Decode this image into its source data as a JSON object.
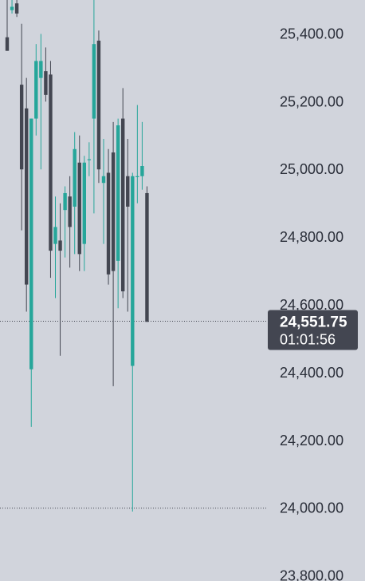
{
  "chart_data": {
    "type": "candlestick",
    "y_axis": {
      "ticks": [
        25400,
        25200,
        25000,
        24800,
        24600,
        24400,
        24200,
        24000,
        23800
      ],
      "tick_labels": [
        "25,400.00",
        "25,200.00",
        "25,000.00",
        "24,800.00",
        "24,600.00",
        "24,400.00",
        "24,200.00",
        "24,000.00",
        "23,800.00"
      ],
      "range": [
        23785,
        25500
      ]
    },
    "current_price": {
      "value": 24551.75,
      "label": "24,551.75",
      "countdown": "01:01:56"
    },
    "low_marker_value": 24000,
    "colors": {
      "background": "#d1d4dc",
      "up": "#26a69a",
      "down": "#434651",
      "badge": "#434651",
      "axis_text": "#2a2e39"
    },
    "candles": [
      {
        "o": 25390,
        "h": 25520,
        "l": 25350,
        "c": 25350
      },
      {
        "o": 25470,
        "h": 25520,
        "l": 25460,
        "c": 25480
      },
      {
        "o": 25490,
        "h": 25520,
        "l": 25450,
        "c": 25460
      },
      {
        "o": 25250,
        "h": 25430,
        "l": 24820,
        "c": 25000
      },
      {
        "o": 25180,
        "h": 25270,
        "l": 24580,
        "c": 24660
      },
      {
        "o": 24410,
        "h": 25150,
        "l": 24240,
        "c": 25150
      },
      {
        "o": 25150,
        "h": 25370,
        "l": 25100,
        "c": 25320
      },
      {
        "o": 25270,
        "h": 25400,
        "l": 25000,
        "c": 25320
      },
      {
        "o": 25290,
        "h": 25360,
        "l": 25200,
        "c": 25220
      },
      {
        "o": 25280,
        "h": 25320,
        "l": 24680,
        "c": 24760
      },
      {
        "o": 24780,
        "h": 24920,
        "l": 24620,
        "c": 24830
      },
      {
        "o": 24790,
        "h": 24900,
        "l": 24450,
        "c": 24760
      },
      {
        "o": 24880,
        "h": 24950,
        "l": 24740,
        "c": 24930
      },
      {
        "o": 24920,
        "h": 24980,
        "l": 24710,
        "c": 24830
      },
      {
        "o": 24890,
        "h": 25110,
        "l": 24750,
        "c": 25060
      },
      {
        "o": 25020,
        "h": 25100,
        "l": 24700,
        "c": 24750
      },
      {
        "o": 24780,
        "h": 25040,
        "l": 24700,
        "c": 25020
      },
      {
        "o": 25030,
        "h": 25080,
        "l": 24980,
        "c": 25030
      },
      {
        "o": 25150,
        "h": 25530,
        "l": 24870,
        "c": 25370
      },
      {
        "o": 25380,
        "h": 25410,
        "l": 24960,
        "c": 25000
      },
      {
        "o": 24960,
        "h": 25090,
        "l": 24780,
        "c": 24980
      },
      {
        "o": 24990,
        "h": 25060,
        "l": 24660,
        "c": 24690
      },
      {
        "o": 25050,
        "h": 25140,
        "l": 24360,
        "c": 24700
      },
      {
        "o": 24730,
        "h": 25150,
        "l": 24590,
        "c": 25130
      },
      {
        "o": 25150,
        "h": 25240,
        "l": 24620,
        "c": 24640
      },
      {
        "o": 24980,
        "h": 25090,
        "l": 24580,
        "c": 24890
      },
      {
        "o": 24420,
        "h": 24990,
        "l": 23990,
        "c": 24980
      },
      {
        "o": 24980,
        "h": 25190,
        "l": 24900,
        "c": 24980
      },
      {
        "o": 24980,
        "h": 25140,
        "l": 24940,
        "c": 25010
      },
      {
        "o": 24930,
        "h": 24950,
        "l": 24550,
        "c": 24550
      }
    ]
  }
}
